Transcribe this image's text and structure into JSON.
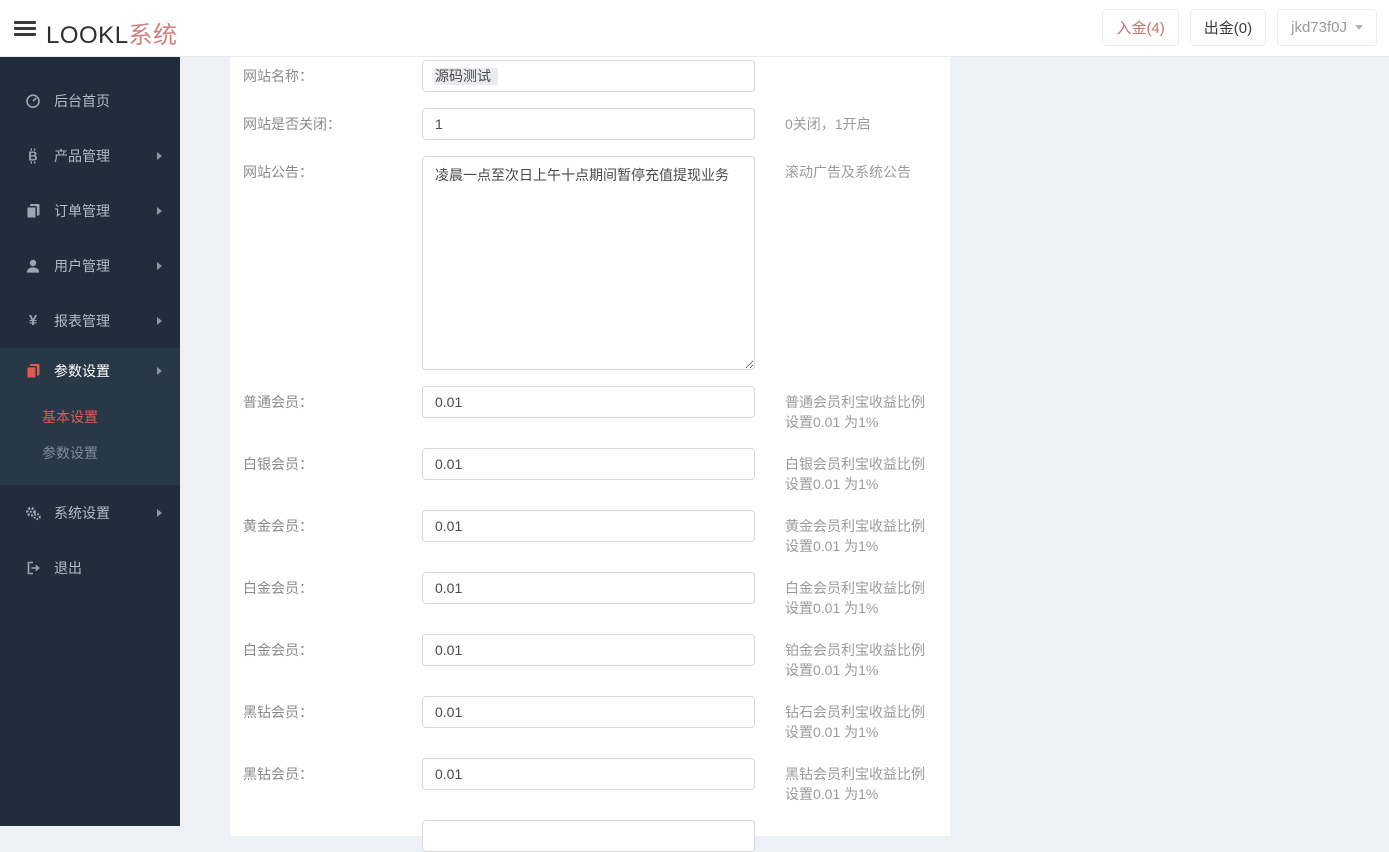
{
  "header": {
    "logo_main": "LOOKL",
    "logo_accent": "系统",
    "deposit_label": "入金(4)",
    "withdraw_label": "出金(0)",
    "username": "jkd73f0J"
  },
  "sidebar": {
    "items": [
      {
        "label": "后台首页",
        "icon": "dashboard-icon",
        "has_arrow": false
      },
      {
        "label": "产品管理",
        "icon": "bitcoin-icon",
        "has_arrow": true
      },
      {
        "label": "订单管理",
        "icon": "files-icon",
        "has_arrow": true
      },
      {
        "label": "用户管理",
        "icon": "user-icon",
        "has_arrow": true
      },
      {
        "label": "报表管理",
        "icon": "yen-icon",
        "has_arrow": true
      },
      {
        "label": "参数设置",
        "icon": "files-icon",
        "has_arrow": true,
        "active": true
      },
      {
        "label": "系统设置",
        "icon": "gears-icon",
        "has_arrow": true
      },
      {
        "label": "退出",
        "icon": "signout-icon",
        "has_arrow": false
      }
    ],
    "submenu": [
      {
        "label": "基本设置",
        "active": true
      },
      {
        "label": "参数设置",
        "active": false
      }
    ]
  },
  "form": {
    "rows": [
      {
        "label": "网站名称：",
        "value": "源码测试",
        "hint": ""
      },
      {
        "label": "网站是否关闭：",
        "value": "1",
        "hint": "0关闭，1开启"
      },
      {
        "label": "网站公告：",
        "value": "凌晨一点至次日上午十点期间暂停充值提现业务",
        "hint": "滚动广告及系统公告"
      },
      {
        "label": "普通会员：",
        "value": "0.01",
        "hint": "普通会员利宝收益比例设置0.01 为1%"
      },
      {
        "label": "白银会员：",
        "value": "0.01",
        "hint": "白银会员利宝收益比例设置0.01 为1%"
      },
      {
        "label": "黄金会员：",
        "value": "0.01",
        "hint": "黄金会员利宝收益比例设置0.01 为1%"
      },
      {
        "label": "白金会员：",
        "value": "0.01",
        "hint": "白金会员利宝收益比例设置0.01 为1%"
      },
      {
        "label": "白金会员：",
        "value": "0.01",
        "hint": "铂金会员利宝收益比例设置0.01 为1%"
      },
      {
        "label": "黑钻会员：",
        "value": "0.01",
        "hint": "钻石会员利宝收益比例设置0.01 为1%"
      },
      {
        "label": "黑钻会员：",
        "value": "0.01",
        "hint": "黑钻会员利宝收益比例设置0.01 为1%"
      }
    ]
  },
  "colors": {
    "accent_red": "#d9534f",
    "logo_accent_red": "#cf817f",
    "active_link_red": "#e05a50",
    "sidebar_bg": "#222d3b",
    "sidebar_active_bg": "#293847",
    "page_bg": "#eef0f7",
    "card_bg": "#ffffff",
    "input_border": "#d9d9d9"
  }
}
